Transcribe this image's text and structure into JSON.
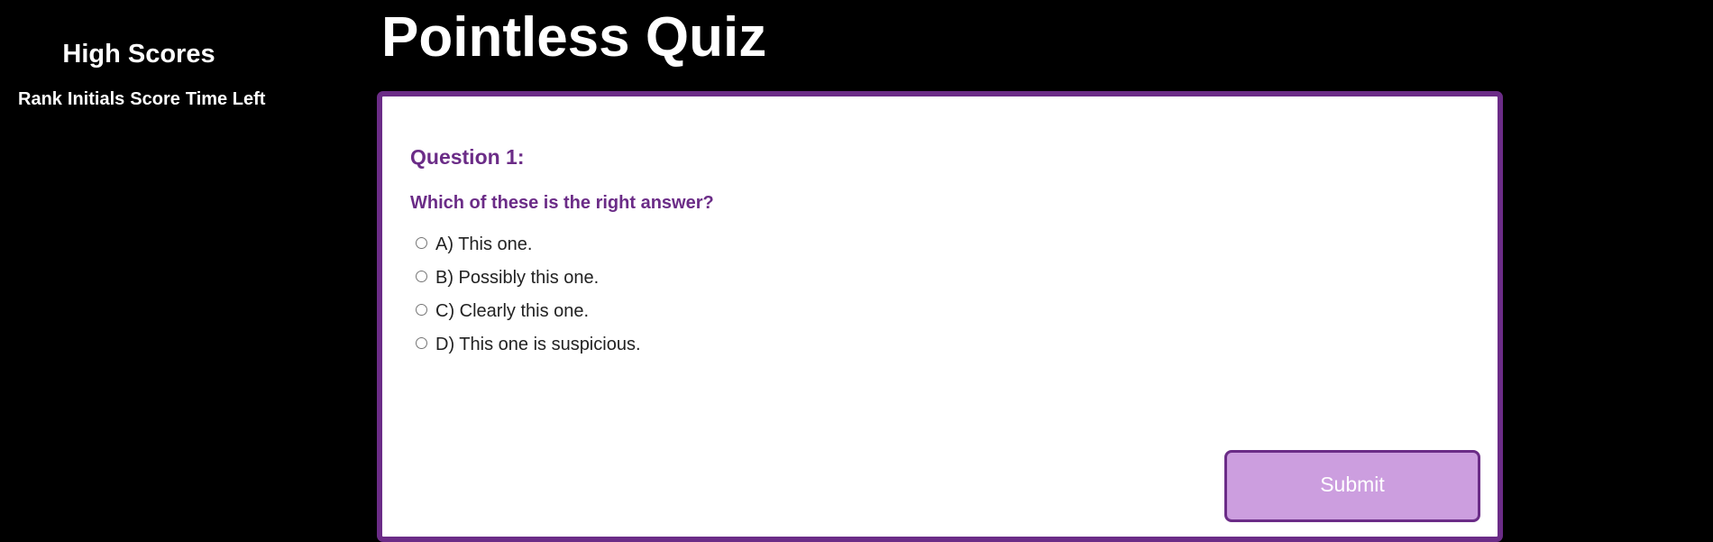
{
  "sidebar": {
    "title": "High Scores",
    "columns": [
      "Rank",
      "Initials",
      "Score",
      "Time Left"
    ]
  },
  "header": {
    "title": "Pointless Quiz"
  },
  "quiz": {
    "question_number": "Question 1:",
    "question_text": "Which of these is the right answer?",
    "answers": [
      "A) This one.",
      "B) Possibly this one.",
      "C) Clearly this one.",
      "D) This one is suspicious."
    ],
    "submit_label": "Submit"
  },
  "colors": {
    "background": "#000000",
    "accent": "#6b2c87",
    "button_fill": "#cc9edf",
    "card": "#ffffff"
  }
}
